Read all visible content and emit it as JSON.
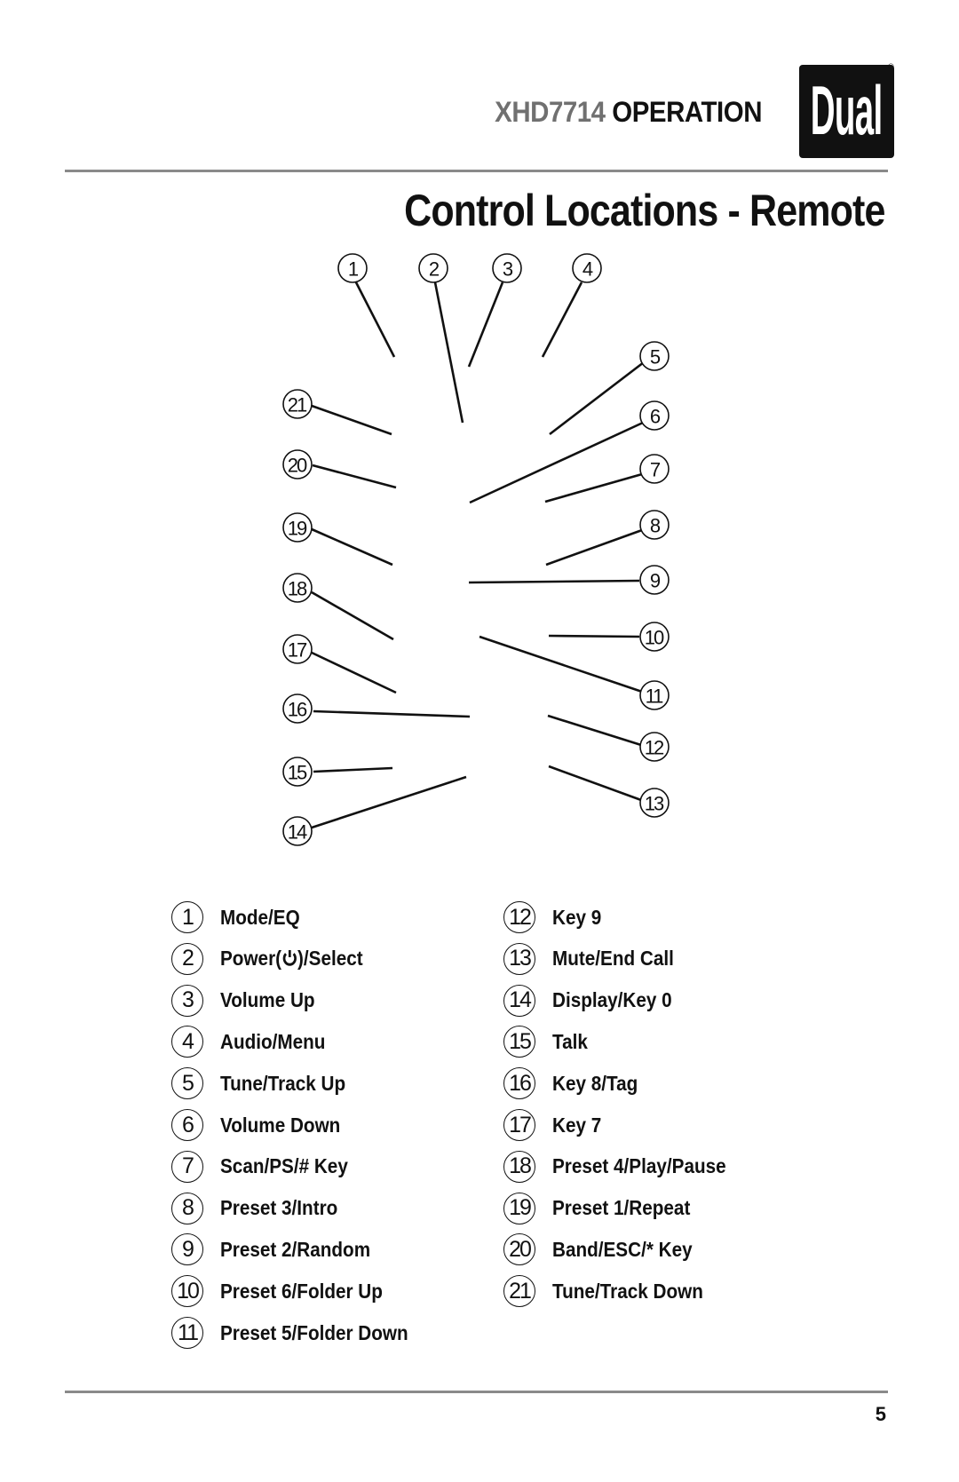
{
  "header": {
    "model": "XHD7714",
    "section": "OPERATION",
    "brand_logo": "Dual",
    "registered_mark": "®"
  },
  "title": "Control Locations - Remote",
  "diagram": {
    "callouts": [
      "1",
      "2",
      "3",
      "4",
      "5",
      "6",
      "7",
      "8",
      "9",
      "10",
      "11",
      "12",
      "13",
      "14",
      "15",
      "16",
      "17",
      "18",
      "19",
      "20",
      "21"
    ]
  },
  "legend": {
    "left_column": [
      {
        "num": "1",
        "label": "Mode/EQ"
      },
      {
        "num": "2",
        "label_before": "Power(",
        "icon": "power-icon",
        "label_after": ")/Select"
      },
      {
        "num": "3",
        "label": "Volume Up"
      },
      {
        "num": "4",
        "label": "Audio/Menu"
      },
      {
        "num": "5",
        "label": "Tune/Track Up"
      },
      {
        "num": "6",
        "label": "Volume Down"
      },
      {
        "num": "7",
        "label": "Scan/PS/# Key"
      },
      {
        "num": "8",
        "label": "Preset 3/Intro"
      },
      {
        "num": "9",
        "label": "Preset 2/Random"
      },
      {
        "num": "10",
        "label": "Preset 6/Folder Up"
      },
      {
        "num": "11",
        "label": "Preset 5/Folder Down"
      }
    ],
    "right_column": [
      {
        "num": "12",
        "label": "Key 9"
      },
      {
        "num": "13",
        "label": "Mute/End Call"
      },
      {
        "num": "14",
        "label": "Display/Key 0"
      },
      {
        "num": "15",
        "label": "Talk"
      },
      {
        "num": "16",
        "label": "Key 8/Tag"
      },
      {
        "num": "17",
        "label": "Key 7"
      },
      {
        "num": "18",
        "label": "Preset 4/Play/Pause"
      },
      {
        "num": "19",
        "label": "Preset 1/Repeat"
      },
      {
        "num": "20",
        "label": "Band/ESC/* Key"
      },
      {
        "num": "21",
        "label": "Tune/Track Down"
      }
    ]
  },
  "footer": {
    "page_number": "5"
  }
}
